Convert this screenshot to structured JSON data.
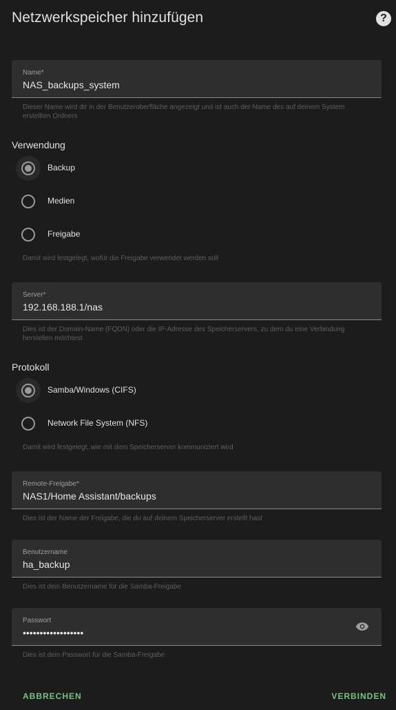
{
  "dialog": {
    "title": "Netzwerkspeicher hinzufügen",
    "help_icon": "help-circle-icon"
  },
  "name_field": {
    "label": "Name*",
    "value": "NAS_backups_system",
    "helper": "Dieser Name wird dir in der Benutzeroberfläche angezeigt und ist auch der Name des auf deinem System erstellten Ordners"
  },
  "usage": {
    "title": "Verwendung",
    "options": [
      {
        "label": "Backup",
        "checked": true
      },
      {
        "label": "Medien",
        "checked": false
      },
      {
        "label": "Freigabe",
        "checked": false
      }
    ],
    "helper": "Damit wird festgelegt, wofür die Freigabe verwendet werden soll"
  },
  "server_field": {
    "label": "Server*",
    "value": "192.168.188.1/nas",
    "helper": "Dies ist der Domain-Name (FQDN) oder die IP-Adresse des Speicherservers, zu dem du eine Verbindung herstellen möchtest"
  },
  "protocol": {
    "title": "Protokoll",
    "options": [
      {
        "label": "Samba/Windows (CIFS)",
        "checked": true
      },
      {
        "label": "Network File System (NFS)",
        "checked": false
      }
    ],
    "helper": "Damit wird festgelegt, wie mit dem Speicherserver kommuniziert wird"
  },
  "share_field": {
    "label": "Remote-Freigabe*",
    "value": "NAS1/Home Assistant/backups",
    "helper": "Dies ist der Name der Freigabe, die du auf deinem Speicherserver erstellt hast"
  },
  "username_field": {
    "label": "Benutzername",
    "value": "ha_backup",
    "helper": "Dies ist dein Benutzername für die Samba-Freigabe"
  },
  "password_field": {
    "label": "Passwort",
    "value": "••••••••••••••••••",
    "helper": "Dies ist dein Passwort für die Samba-Freigabe",
    "icon": "eye-icon"
  },
  "actions": {
    "cancel": "ABBRECHEN",
    "connect": "VERBINDEN",
    "accent_color": "#7cbf88"
  }
}
